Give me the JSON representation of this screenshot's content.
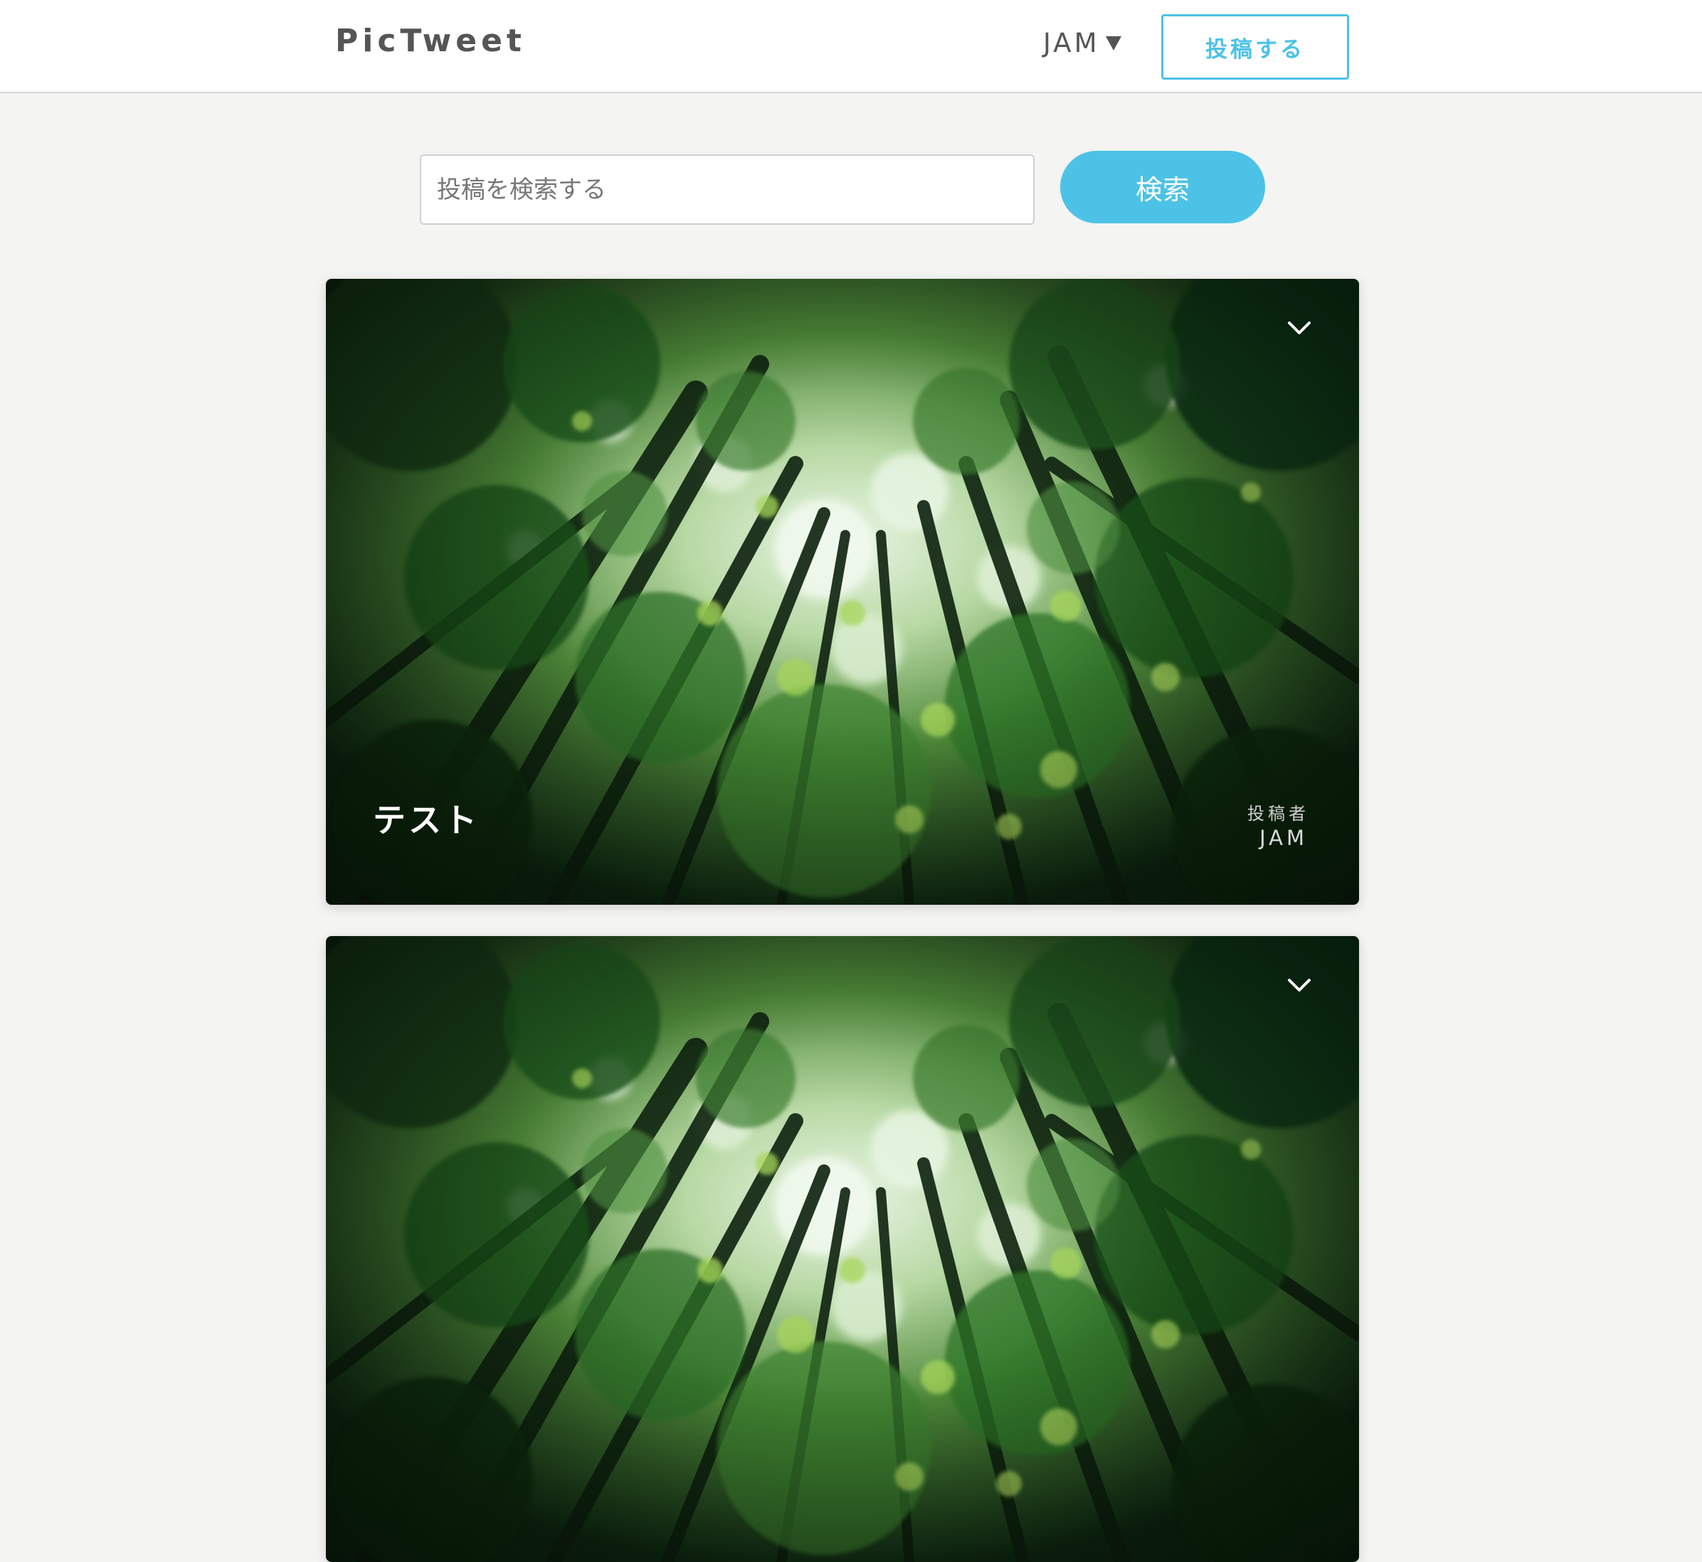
{
  "header": {
    "logo": "PicTweet",
    "user_name": "JAM",
    "post_button": "投稿する"
  },
  "search": {
    "placeholder": "投稿を検索する",
    "button": "検索"
  },
  "posts": [
    {
      "title": "テスト",
      "author_label": "投稿者",
      "author": "JAM",
      "image": "forest canopy photo"
    },
    {
      "title": "",
      "author_label": "",
      "author": "",
      "image": "forest canopy photo"
    }
  ],
  "icons": {
    "card_menu": "chevron-down-icon",
    "user_dropdown": "caret-down-icon"
  },
  "colors": {
    "accent": "#4dc2e7",
    "background": "#f4f4f2",
    "header_bg": "#ffffff",
    "logo_text": "#555555"
  }
}
